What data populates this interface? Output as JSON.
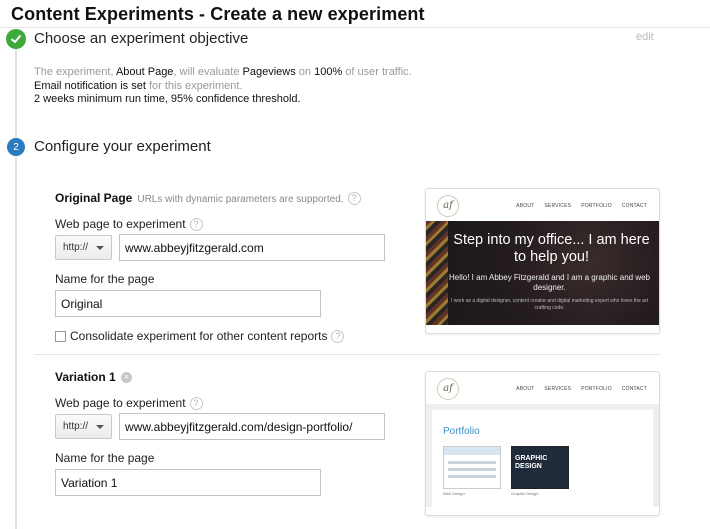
{
  "page": {
    "title": "Content Experiments - Create a new experiment"
  },
  "step1": {
    "title": "Choose an experiment objective",
    "edit_label": "edit",
    "summary": {
      "part1": "The experiment, ",
      "page_name": "About Page",
      "part2": ", will evaluate ",
      "metric": "Pageviews",
      "part3": " on ",
      "traffic": "100%",
      "part4": " of user traffic.",
      "email_bold": "Email notification is set",
      "email_rest": " for this experiment.",
      "runtime": "2 weeks minimum run time, 95% confidence threshold."
    }
  },
  "step2": {
    "number": "2",
    "title": "Configure your experiment"
  },
  "original": {
    "heading": "Original Page",
    "note": "URLs with dynamic parameters are supported.",
    "help": "?",
    "url_label": "Web page to experiment",
    "protocol": "http://",
    "url_value": "www.abbeyjfitzgerald.com",
    "name_label": "Name for the page",
    "name_value": "Original",
    "consolidate_label": "Consolidate experiment for other content reports"
  },
  "variation1": {
    "heading": "Variation 1",
    "remove": "×",
    "url_label": "Web page to experiment",
    "protocol": "http://",
    "url_value": "www.abbeyjfitzgerald.com/design-portfolio/",
    "name_label": "Name for the page",
    "name_value": "Variation 1"
  },
  "preview_original": {
    "logo": "af",
    "nav": [
      "ABOUT",
      "SERVICES",
      "PORTFOLIO",
      "CONTACT"
    ],
    "headline": "Step into my office... I am here to help you!",
    "intro": "Hello! I am Abbey Fitzgerald and I am a graphic and web designer.",
    "detail": "I work as a digital designer, content creator and digital marketing expert who loves the art crafting code."
  },
  "preview_variation": {
    "logo": "af",
    "nav": [
      "ABOUT",
      "SERVICES",
      "PORTFOLIO",
      "CONTACT"
    ],
    "heading": "Portfolio",
    "thumb2_text": "GRAPHIC DESIGN",
    "caption1": "Web Design",
    "caption2": "Graphic Design"
  },
  "colors": {
    "check_green": "#3fa83b",
    "step_blue": "#2b7bbf",
    "link_blue": "#3a8fc4"
  }
}
